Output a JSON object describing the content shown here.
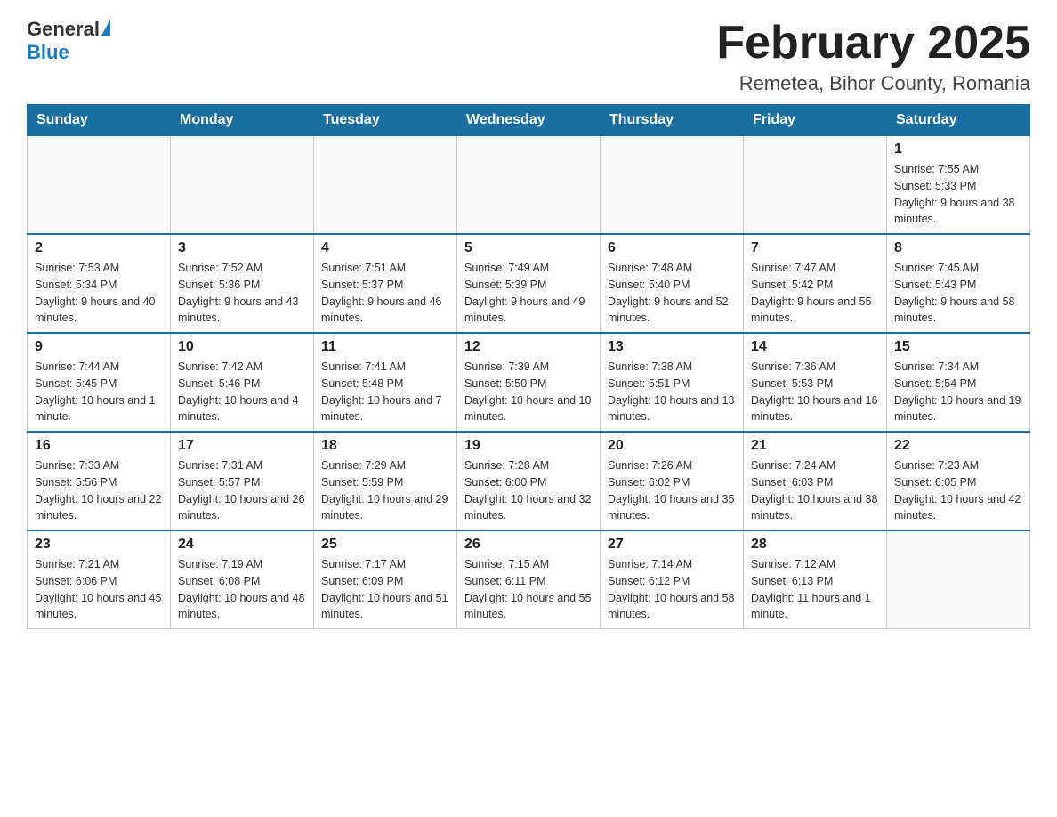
{
  "logo": {
    "general": "General",
    "blue": "Blue"
  },
  "header": {
    "month_year": "February 2025",
    "location": "Remetea, Bihor County, Romania"
  },
  "days_of_week": [
    "Sunday",
    "Monday",
    "Tuesday",
    "Wednesday",
    "Thursday",
    "Friday",
    "Saturday"
  ],
  "weeks": [
    [
      {
        "day": "",
        "info": ""
      },
      {
        "day": "",
        "info": ""
      },
      {
        "day": "",
        "info": ""
      },
      {
        "day": "",
        "info": ""
      },
      {
        "day": "",
        "info": ""
      },
      {
        "day": "",
        "info": ""
      },
      {
        "day": "1",
        "info": "Sunrise: 7:55 AM\nSunset: 5:33 PM\nDaylight: 9 hours and 38 minutes."
      }
    ],
    [
      {
        "day": "2",
        "info": "Sunrise: 7:53 AM\nSunset: 5:34 PM\nDaylight: 9 hours and 40 minutes."
      },
      {
        "day": "3",
        "info": "Sunrise: 7:52 AM\nSunset: 5:36 PM\nDaylight: 9 hours and 43 minutes."
      },
      {
        "day": "4",
        "info": "Sunrise: 7:51 AM\nSunset: 5:37 PM\nDaylight: 9 hours and 46 minutes."
      },
      {
        "day": "5",
        "info": "Sunrise: 7:49 AM\nSunset: 5:39 PM\nDaylight: 9 hours and 49 minutes."
      },
      {
        "day": "6",
        "info": "Sunrise: 7:48 AM\nSunset: 5:40 PM\nDaylight: 9 hours and 52 minutes."
      },
      {
        "day": "7",
        "info": "Sunrise: 7:47 AM\nSunset: 5:42 PM\nDaylight: 9 hours and 55 minutes."
      },
      {
        "day": "8",
        "info": "Sunrise: 7:45 AM\nSunset: 5:43 PM\nDaylight: 9 hours and 58 minutes."
      }
    ],
    [
      {
        "day": "9",
        "info": "Sunrise: 7:44 AM\nSunset: 5:45 PM\nDaylight: 10 hours and 1 minute."
      },
      {
        "day": "10",
        "info": "Sunrise: 7:42 AM\nSunset: 5:46 PM\nDaylight: 10 hours and 4 minutes."
      },
      {
        "day": "11",
        "info": "Sunrise: 7:41 AM\nSunset: 5:48 PM\nDaylight: 10 hours and 7 minutes."
      },
      {
        "day": "12",
        "info": "Sunrise: 7:39 AM\nSunset: 5:50 PM\nDaylight: 10 hours and 10 minutes."
      },
      {
        "day": "13",
        "info": "Sunrise: 7:38 AM\nSunset: 5:51 PM\nDaylight: 10 hours and 13 minutes."
      },
      {
        "day": "14",
        "info": "Sunrise: 7:36 AM\nSunset: 5:53 PM\nDaylight: 10 hours and 16 minutes."
      },
      {
        "day": "15",
        "info": "Sunrise: 7:34 AM\nSunset: 5:54 PM\nDaylight: 10 hours and 19 minutes."
      }
    ],
    [
      {
        "day": "16",
        "info": "Sunrise: 7:33 AM\nSunset: 5:56 PM\nDaylight: 10 hours and 22 minutes."
      },
      {
        "day": "17",
        "info": "Sunrise: 7:31 AM\nSunset: 5:57 PM\nDaylight: 10 hours and 26 minutes."
      },
      {
        "day": "18",
        "info": "Sunrise: 7:29 AM\nSunset: 5:59 PM\nDaylight: 10 hours and 29 minutes."
      },
      {
        "day": "19",
        "info": "Sunrise: 7:28 AM\nSunset: 6:00 PM\nDaylight: 10 hours and 32 minutes."
      },
      {
        "day": "20",
        "info": "Sunrise: 7:26 AM\nSunset: 6:02 PM\nDaylight: 10 hours and 35 minutes."
      },
      {
        "day": "21",
        "info": "Sunrise: 7:24 AM\nSunset: 6:03 PM\nDaylight: 10 hours and 38 minutes."
      },
      {
        "day": "22",
        "info": "Sunrise: 7:23 AM\nSunset: 6:05 PM\nDaylight: 10 hours and 42 minutes."
      }
    ],
    [
      {
        "day": "23",
        "info": "Sunrise: 7:21 AM\nSunset: 6:06 PM\nDaylight: 10 hours and 45 minutes."
      },
      {
        "day": "24",
        "info": "Sunrise: 7:19 AM\nSunset: 6:08 PM\nDaylight: 10 hours and 48 minutes."
      },
      {
        "day": "25",
        "info": "Sunrise: 7:17 AM\nSunset: 6:09 PM\nDaylight: 10 hours and 51 minutes."
      },
      {
        "day": "26",
        "info": "Sunrise: 7:15 AM\nSunset: 6:11 PM\nDaylight: 10 hours and 55 minutes."
      },
      {
        "day": "27",
        "info": "Sunrise: 7:14 AM\nSunset: 6:12 PM\nDaylight: 10 hours and 58 minutes."
      },
      {
        "day": "28",
        "info": "Sunrise: 7:12 AM\nSunset: 6:13 PM\nDaylight: 11 hours and 1 minute."
      },
      {
        "day": "",
        "info": ""
      }
    ]
  ]
}
